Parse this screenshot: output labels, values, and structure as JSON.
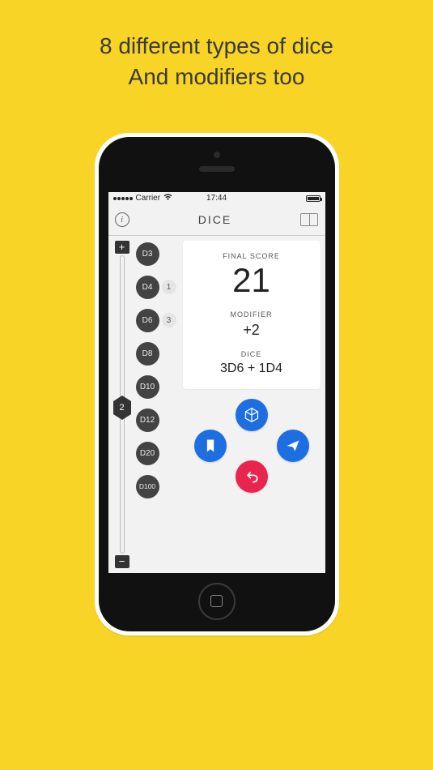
{
  "promo": {
    "line1": "8 different types of dice",
    "line2": "And modifiers too"
  },
  "statusbar": {
    "carrier": "Carrier",
    "time": "17:44"
  },
  "navbar": {
    "title": "DICE"
  },
  "slider": {
    "plus": "+",
    "minus": "−",
    "value": "2"
  },
  "dice_types": [
    {
      "label": "D3",
      "count": null
    },
    {
      "label": "D4",
      "count": "1"
    },
    {
      "label": "D6",
      "count": "3"
    },
    {
      "label": "D8",
      "count": null
    },
    {
      "label": "D10",
      "count": null
    },
    {
      "label": "D12",
      "count": null
    },
    {
      "label": "D20",
      "count": null
    },
    {
      "label": "D100",
      "count": null
    }
  ],
  "score": {
    "final_label": "FINAL SCORE",
    "final_value": "21",
    "modifier_label": "MODIFIER",
    "modifier_value": "+2",
    "dice_label": "DICE",
    "dice_expr": "3D6 + 1D4"
  },
  "action_icons": {
    "top": "cube-icon",
    "left": "bookmark-icon",
    "right": "send-icon",
    "bottom": "undo-icon"
  }
}
